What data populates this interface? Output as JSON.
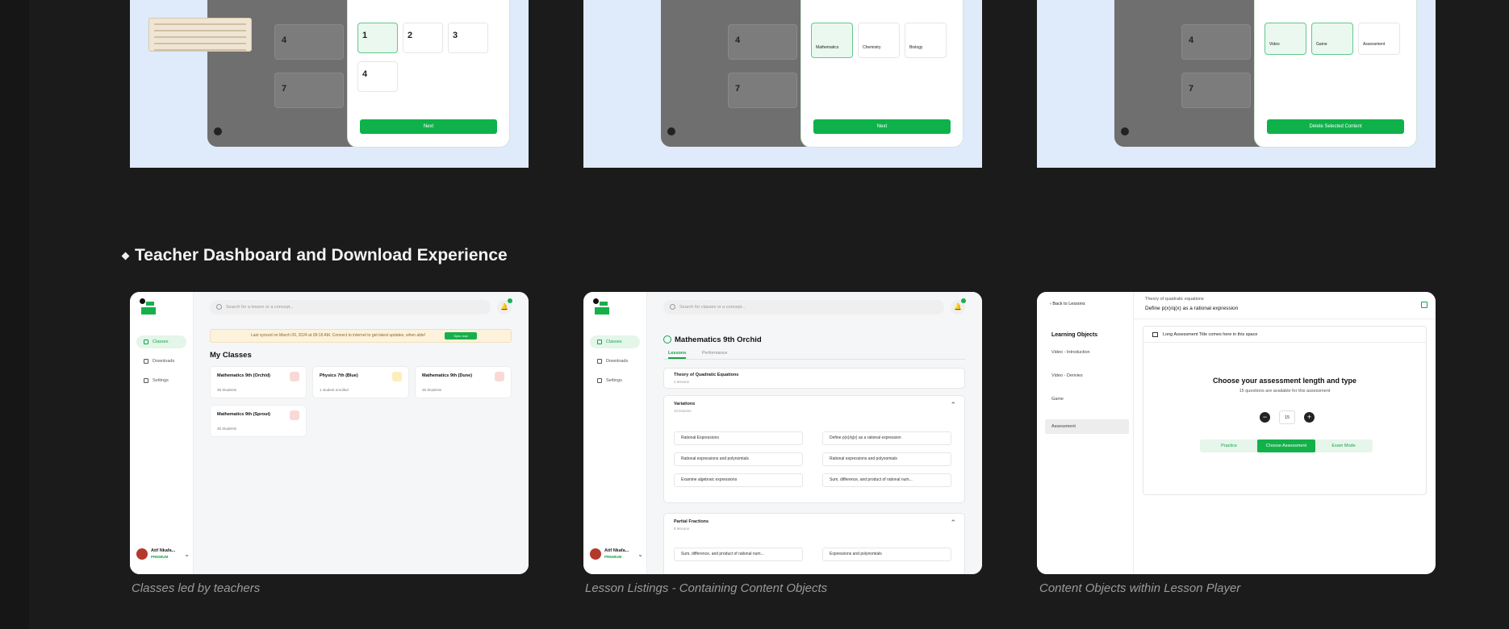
{
  "section": {
    "title": "Teacher Dashboard and Download Experience"
  },
  "top_row": [
    {
      "numbers": [
        "1",
        "2",
        "3",
        "4"
      ],
      "dark_numbers": [
        "4",
        "7"
      ],
      "button": "Next"
    },
    {
      "subjects": [
        "Mathematics",
        "Chemistry",
        "Biology"
      ],
      "dark_numbers": [
        "4",
        "7"
      ],
      "button": "Next"
    },
    {
      "types": [
        "Video",
        "Game",
        "Assessment"
      ],
      "dark_numbers": [
        "4",
        "7"
      ],
      "button": "Delete Selected Content"
    }
  ],
  "dashboard": {
    "search_placeholder": "Search for a lesson or a concept...",
    "nav": [
      "Classes",
      "Downloads",
      "Settings"
    ],
    "banner": "Last synced on March 09, 2024 at 09:18 AM. Connect to internet to get latest updates, when able!",
    "banner_button": "Sync now",
    "heading": "My Classes",
    "classes": [
      {
        "name": "Mathematics 9th (Orchid)",
        "students": "35 Students"
      },
      {
        "name": "Physics 7th (Blue)",
        "students": "1 student enrolled"
      },
      {
        "name": "Mathematics 9th (Dune)",
        "students": "35 Students"
      },
      {
        "name": "Mathematics 9th (Sprout)",
        "students": "35 Students"
      }
    ],
    "user_name": "Atif Nkafa...",
    "user_plan": "PREMIUM"
  },
  "lessons": {
    "search_placeholder": "Search for classes or a concept...",
    "nav": [
      "Classes",
      "Downloads",
      "Settings"
    ],
    "title": "Mathematics 9th Orchid",
    "tabs": [
      "Lessons",
      "Performance"
    ],
    "top_panel": {
      "title": "Theory of Quadratic Equations",
      "sub": "4 lessons"
    },
    "variations": {
      "title": "Variations",
      "sub": "10 lessons",
      "items": [
        "Rational Expressions",
        "Define p(x)/q(x) as a rational expression",
        "Rational expressions and polynomials",
        "Rational expressions and polynomials",
        "Examine algebraic expressions",
        "Sum, difference, and product of rational num..."
      ]
    },
    "partial": {
      "title": "Partial Fractions",
      "sub": "8 lessons",
      "items": [
        "Sum, difference, and product of rational num...",
        "Expressions and polynomials"
      ]
    },
    "user_name": "Atif Nkafa...",
    "user_plan": "PREMIUM"
  },
  "player": {
    "back": "Back to Lessons",
    "crumb": "Theory of quadratic equations",
    "lesson": "Define p(x)/q(x) as a rational expression",
    "sidebar_heading": "Learning Objects",
    "sidebar_items": [
      "Video - Introduction",
      "Video - Derivies",
      "Game",
      "Assessment"
    ],
    "box_header": "Long Assessment Title comes here in this space",
    "box_title": "Choose your assessment length and type",
    "box_sub": "15 questions are available for this assessment",
    "stepper_value": "15",
    "modes": [
      "Practice",
      "Choose Assessment",
      "Exam Mode"
    ]
  },
  "captions": [
    "Classes led by teachers",
    "Lesson Listings - Containing Content Objects",
    "Content Objects within Lesson Player"
  ]
}
